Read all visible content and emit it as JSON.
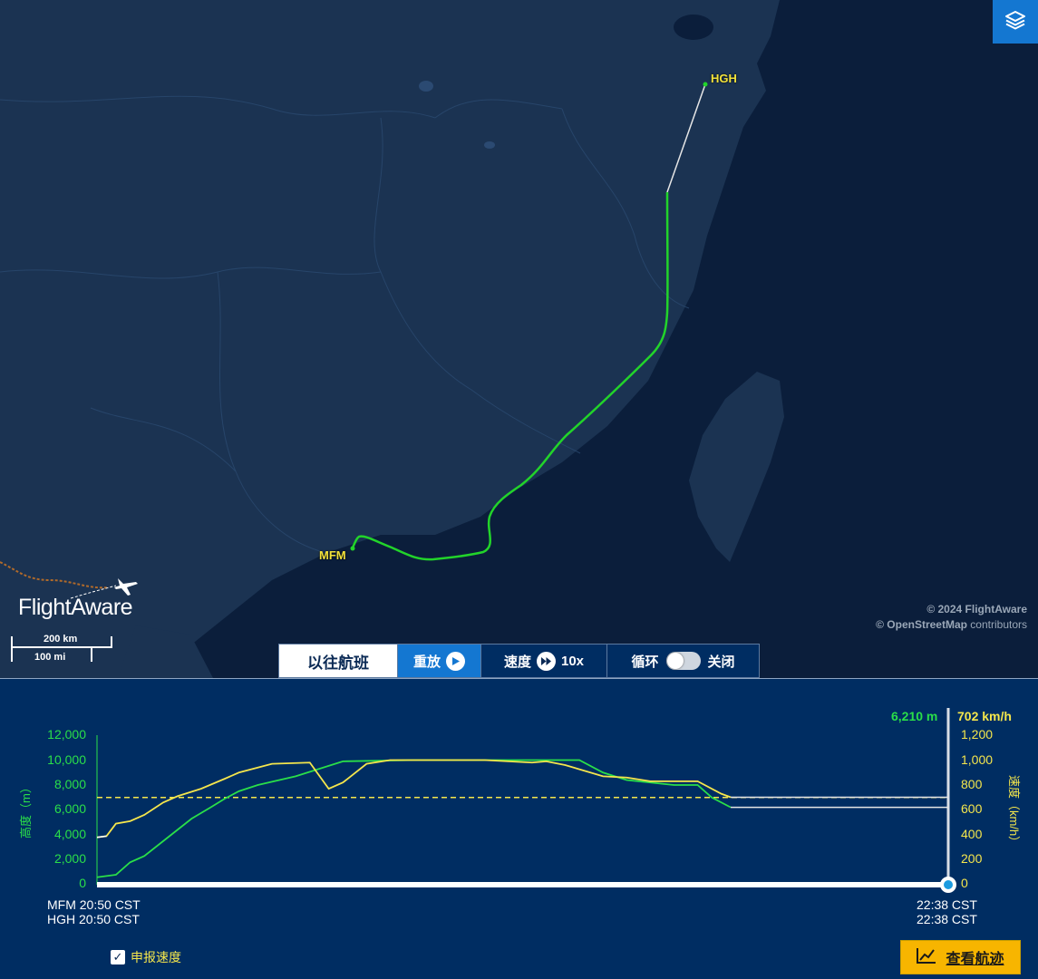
{
  "map": {
    "origin_code": "MFM",
    "destination_code": "HGH",
    "copyright_line1": "© 2024 FlightAware",
    "copyright_line2_bold": "© OpenStreetMap",
    "copyright_line2_rest": " contributors",
    "logo_text": "FlightAware",
    "scale_km": "200 km",
    "scale_mi": "100 mi",
    "layers_icon": "layers-icon",
    "colors": {
      "track": "#22d42a",
      "planned": "#e6e6e6",
      "label": "#f2e23a",
      "sea": "#0b1e3b",
      "land": "#1b3352"
    }
  },
  "controls": {
    "past_flights": "以往航班",
    "replay": "重放",
    "speed_label": "速度",
    "speed_value": "10x",
    "loop_label": "循环",
    "loop_state": "关闭"
  },
  "graph": {
    "current_altitude": "6,210 m",
    "current_speed": "702 km/h",
    "altitude_axis_title": "高度（m）",
    "speed_axis_title": "速度（km/h）",
    "altitude_ticks": [
      "12,000",
      "10,000",
      "8,000",
      "6,000",
      "4,000",
      "2,000",
      "0"
    ],
    "speed_ticks": [
      "1,200",
      "1,000",
      "800",
      "600",
      "400",
      "200",
      "0"
    ],
    "start_time_origin": "MFM 20:50 CST",
    "start_time_dest": "HGH 20:50 CST",
    "end_time_origin": "22:38 CST",
    "end_time_dest": "22:38 CST",
    "reported_speed_label": "申报速度",
    "reported_speed_checked": true,
    "view_track_button": "查看航迹",
    "colors": {
      "altitude": "#2adf49",
      "speed": "#f5e64c",
      "filed_speed": "#f5e64c",
      "background": "#002d62"
    }
  },
  "chart_data": {
    "type": "line",
    "xlabel": "",
    "x_range": [
      "20:50",
      "22:38"
    ],
    "series": [
      {
        "name": "高度",
        "unit": "m",
        "x": [
          20.83,
          20.87,
          20.9,
          20.93,
          20.97,
          21.0,
          21.03,
          21.07,
          21.1,
          21.13,
          21.17,
          21.25,
          21.35,
          21.5,
          21.6,
          21.7,
          21.75,
          21.8,
          21.85,
          21.9,
          21.95,
          22.0,
          22.05,
          22.1,
          22.13,
          22.17
        ],
        "values": [
          600,
          800,
          1800,
          2300,
          3500,
          4400,
          5300,
          6200,
          6900,
          7500,
          8000,
          8700,
          9900,
          10000,
          10000,
          10000,
          10000,
          10000,
          10000,
          9000,
          8400,
          8200,
          8000,
          8000,
          7000,
          6210
        ]
      },
      {
        "name": "速度",
        "unit": "km/h",
        "x": [
          20.83,
          20.85,
          20.87,
          20.9,
          20.93,
          20.97,
          21.0,
          21.05,
          21.1,
          21.13,
          21.2,
          21.28,
          21.32,
          21.35,
          21.4,
          21.45,
          21.55,
          21.65,
          21.75,
          21.78,
          21.82,
          21.9,
          21.95,
          22.0,
          22.05,
          22.1,
          22.15,
          22.17
        ],
        "values": [
          380,
          390,
          490,
          510,
          560,
          660,
          710,
          770,
          850,
          900,
          970,
          980,
          770,
          820,
          970,
          1000,
          1000,
          1000,
          980,
          990,
          960,
          870,
          860,
          830,
          830,
          830,
          730,
          702
        ]
      }
    ],
    "filed_speed": 700,
    "altitude_ylim": [
      0,
      12000
    ],
    "speed_ylim": [
      0,
      1200
    ]
  }
}
